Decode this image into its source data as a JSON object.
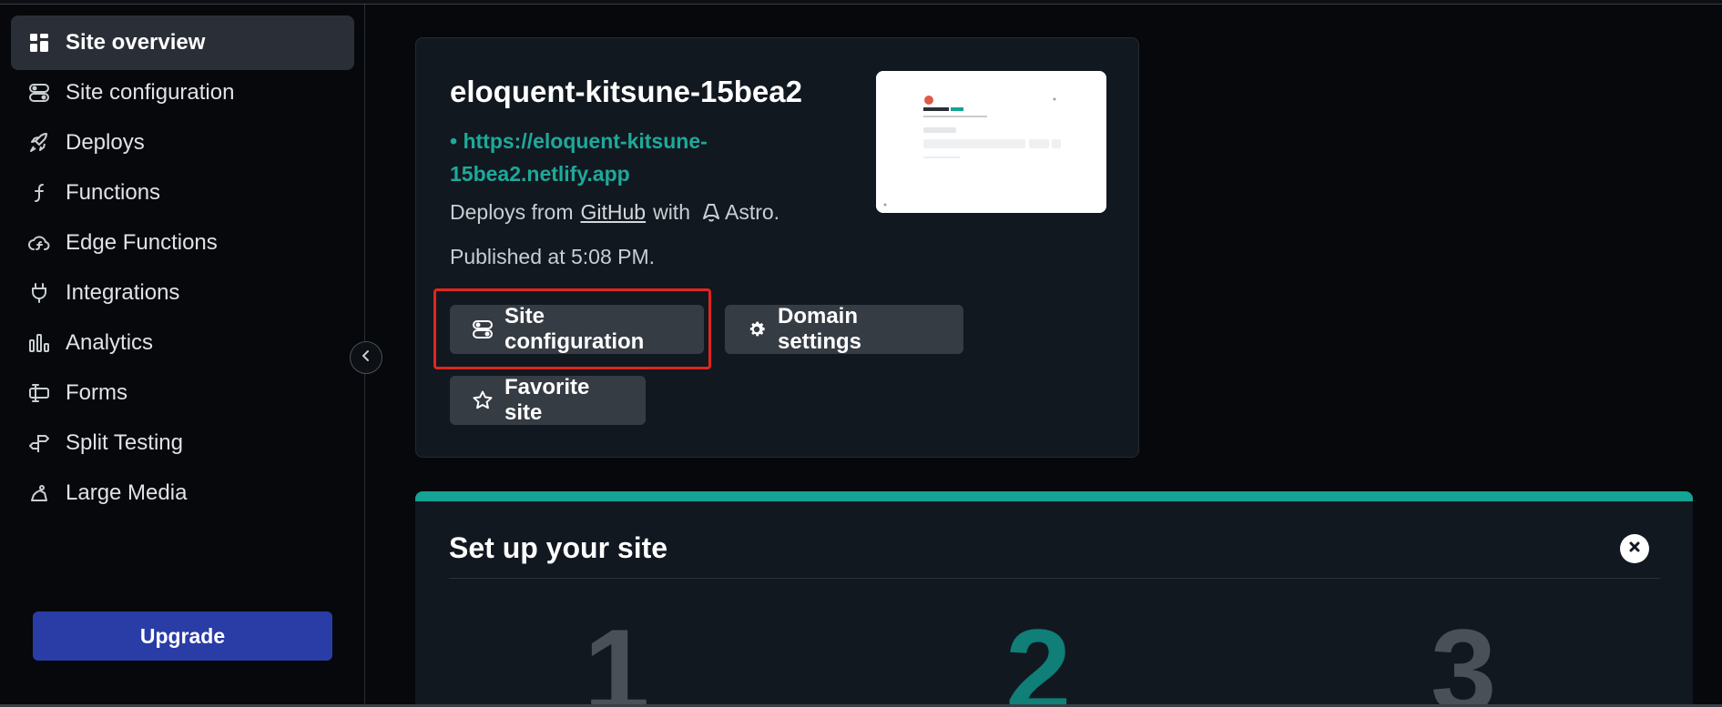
{
  "sidebar": {
    "items": [
      {
        "label": "Site overview",
        "icon": "grid-icon",
        "active": true
      },
      {
        "label": "Site configuration",
        "icon": "toggles-icon"
      },
      {
        "label": "Deploys",
        "icon": "rocket-icon"
      },
      {
        "label": "Functions",
        "icon": "function-icon"
      },
      {
        "label": "Edge Functions",
        "icon": "cloud-function-icon"
      },
      {
        "label": "Integrations",
        "icon": "plug-icon"
      },
      {
        "label": "Analytics",
        "icon": "bar-chart-icon"
      },
      {
        "label": "Forms",
        "icon": "form-icon"
      },
      {
        "label": "Split Testing",
        "icon": "signpost-icon"
      },
      {
        "label": "Large Media",
        "icon": "media-icon"
      }
    ],
    "upgrade_label": "Upgrade"
  },
  "site": {
    "name": "eloquent-kitsune-15bea2",
    "url": "https://eloquent-kitsune-15bea2.netlify.app",
    "deploys_prefix": "Deploys from",
    "deploys_source": "GitHub",
    "deploys_with": "with",
    "framework": "Astro.",
    "published": "Published at 5:08 PM.",
    "buttons": {
      "site_configuration": "Site configuration",
      "domain_settings": "Domain settings",
      "favorite_site": "Favorite site"
    }
  },
  "setup": {
    "title": "Set up your site",
    "steps": [
      "1",
      "2",
      "3"
    ]
  },
  "colors": {
    "accent": "#14a394",
    "upgrade": "#2a3ca6",
    "highlight": "#e0261e"
  }
}
